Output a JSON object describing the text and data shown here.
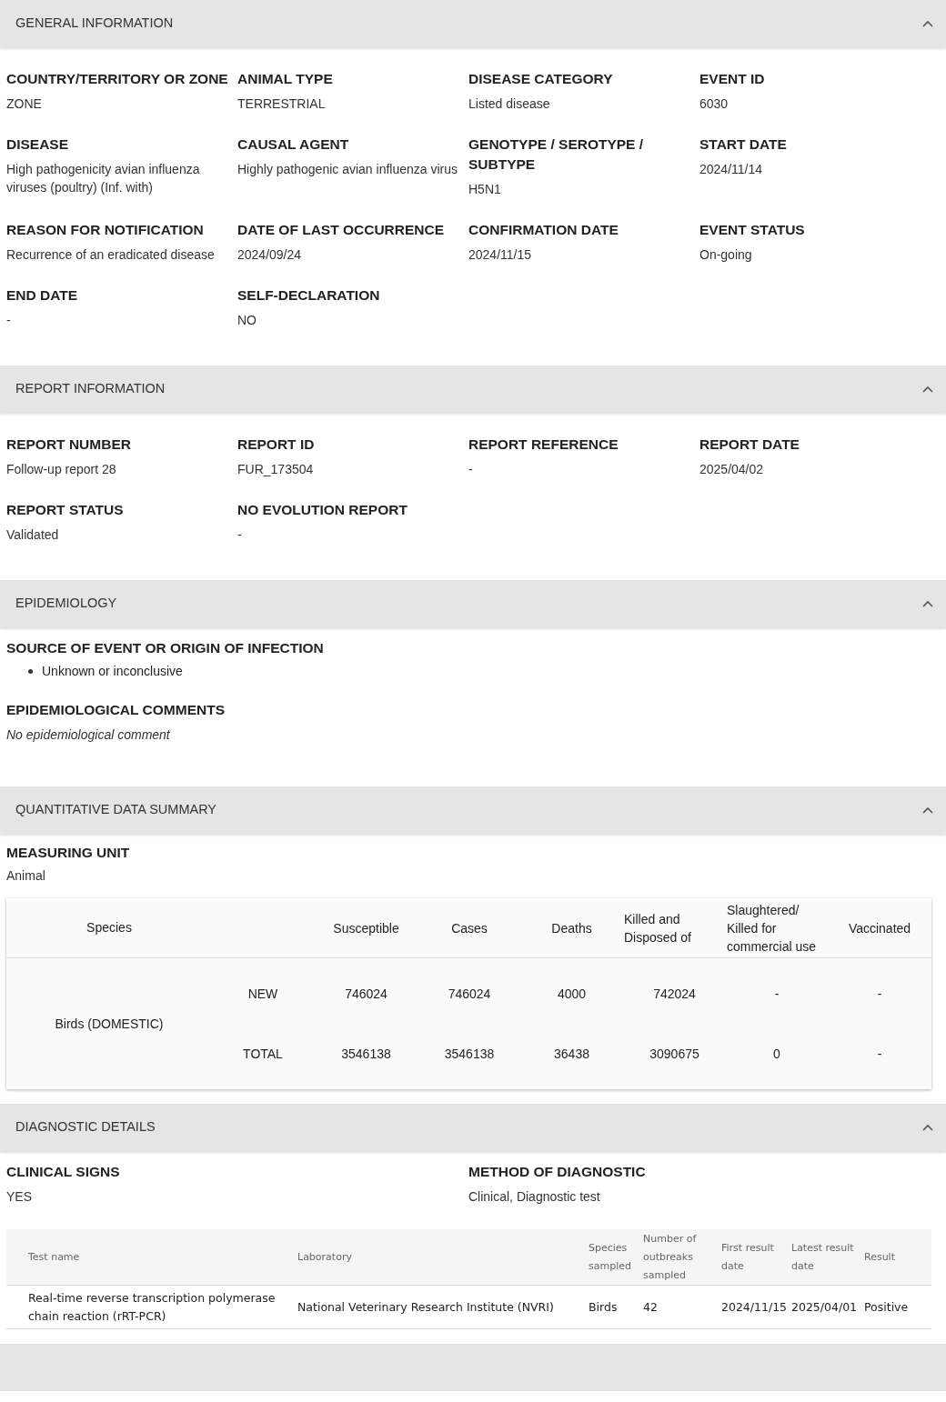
{
  "sections": [
    {
      "kind": "fields",
      "title": "GENERAL INFORMATION",
      "expanded": true,
      "fields": [
        {
          "label": "COUNTRY/TERRITORY OR ZONE",
          "value": "ZONE"
        },
        {
          "label": "ANIMAL TYPE",
          "value": "TERRESTRIAL"
        },
        {
          "label": "DISEASE CATEGORY",
          "value": "Listed disease"
        },
        {
          "label": "EVENT ID",
          "value": "6030"
        },
        {
          "label": "DISEASE",
          "value": "High pathogenicity avian influenza viruses (poultry) (Inf. with)"
        },
        {
          "label": "CAUSAL AGENT",
          "value": "Highly pathogenic avian influenza virus"
        },
        {
          "label": "GENOTYPE / SEROTYPE / SUBTYPE",
          "value": "H5N1"
        },
        {
          "label": "START DATE",
          "value": "2024/11/14"
        },
        {
          "label": "REASON FOR NOTIFICATION",
          "value": "Recurrence of an eradicated disease"
        },
        {
          "label": "DATE OF LAST OCCURRENCE",
          "value": "2024/09/24"
        },
        {
          "label": "CONFIRMATION DATE",
          "value": "2024/11/15"
        },
        {
          "label": "EVENT STATUS",
          "value": "On-going"
        },
        {
          "label": "END DATE",
          "value": "-"
        },
        {
          "label": "SELF-DECLARATION",
          "value": "NO"
        }
      ]
    },
    {
      "kind": "fields",
      "title": "REPORT INFORMATION",
      "expanded": true,
      "fields": [
        {
          "label": "REPORT NUMBER",
          "value": "Follow-up report 28"
        },
        {
          "label": "REPORT ID",
          "value": "FUR_173504"
        },
        {
          "label": "REPORT REFERENCE",
          "value": "-"
        },
        {
          "label": "REPORT DATE",
          "value": "2025/04/02"
        },
        {
          "label": "REPORT STATUS",
          "value": "Validated"
        },
        {
          "label": "NO EVOLUTION REPORT",
          "value": "-"
        }
      ]
    },
    {
      "kind": "epidemiology",
      "title": "EPIDEMIOLOGY",
      "expanded": true,
      "source_label": "SOURCE OF EVENT OR ORIGIN OF INFECTION",
      "sources": [
        "Unknown or inconclusive"
      ],
      "comments_label": "EPIDEMIOLOGICAL COMMENTS",
      "comment": "No epidemiological comment"
    },
    {
      "kind": "quantitative",
      "title": "QUANTITATIVE DATA SUMMARY",
      "expanded": true,
      "unit_label": "MEASURING UNIT",
      "unit": "Animal",
      "table": {
        "columns": [
          "Species",
          "Susceptible",
          "Cases",
          "Deaths",
          "Killed and Disposed of",
          "Slaughtered/ Killed for commercial use",
          "Vaccinated"
        ],
        "rows": [
          {
            "species": "Birds (DOMESTIC)",
            "lines": [
              {
                "label": "NEW",
                "values": [
                  "746024",
                  "746024",
                  "4000",
                  "742024",
                  "-",
                  "-"
                ]
              },
              {
                "label": "TOTAL",
                "values": [
                  "3546138",
                  "3546138",
                  "36438",
                  "3090675",
                  "0",
                  "-"
                ]
              }
            ]
          }
        ]
      }
    },
    {
      "kind": "diagnostic",
      "title": "DIAGNOSTIC DETAILS",
      "expanded": true,
      "fields": [
        {
          "label": "CLINICAL SIGNS",
          "value": "YES"
        },
        {
          "label": "METHOD OF DIAGNOSTIC",
          "value": "Clinical, Diagnostic test"
        }
      ],
      "table": {
        "columns": [
          "Test name",
          "Laboratory",
          "Species sampled",
          "Number of outbreaks sampled",
          "First result date",
          "Latest result date",
          "Result"
        ],
        "rows": [
          [
            "Real-time reverse transcription polymerase chain reaction (rRT-PCR)",
            "National Veterinary Research Institute (NVRI)",
            "Birds",
            "42",
            "2024/11/15",
            "2025/04/01",
            "Positive"
          ]
        ]
      }
    }
  ]
}
